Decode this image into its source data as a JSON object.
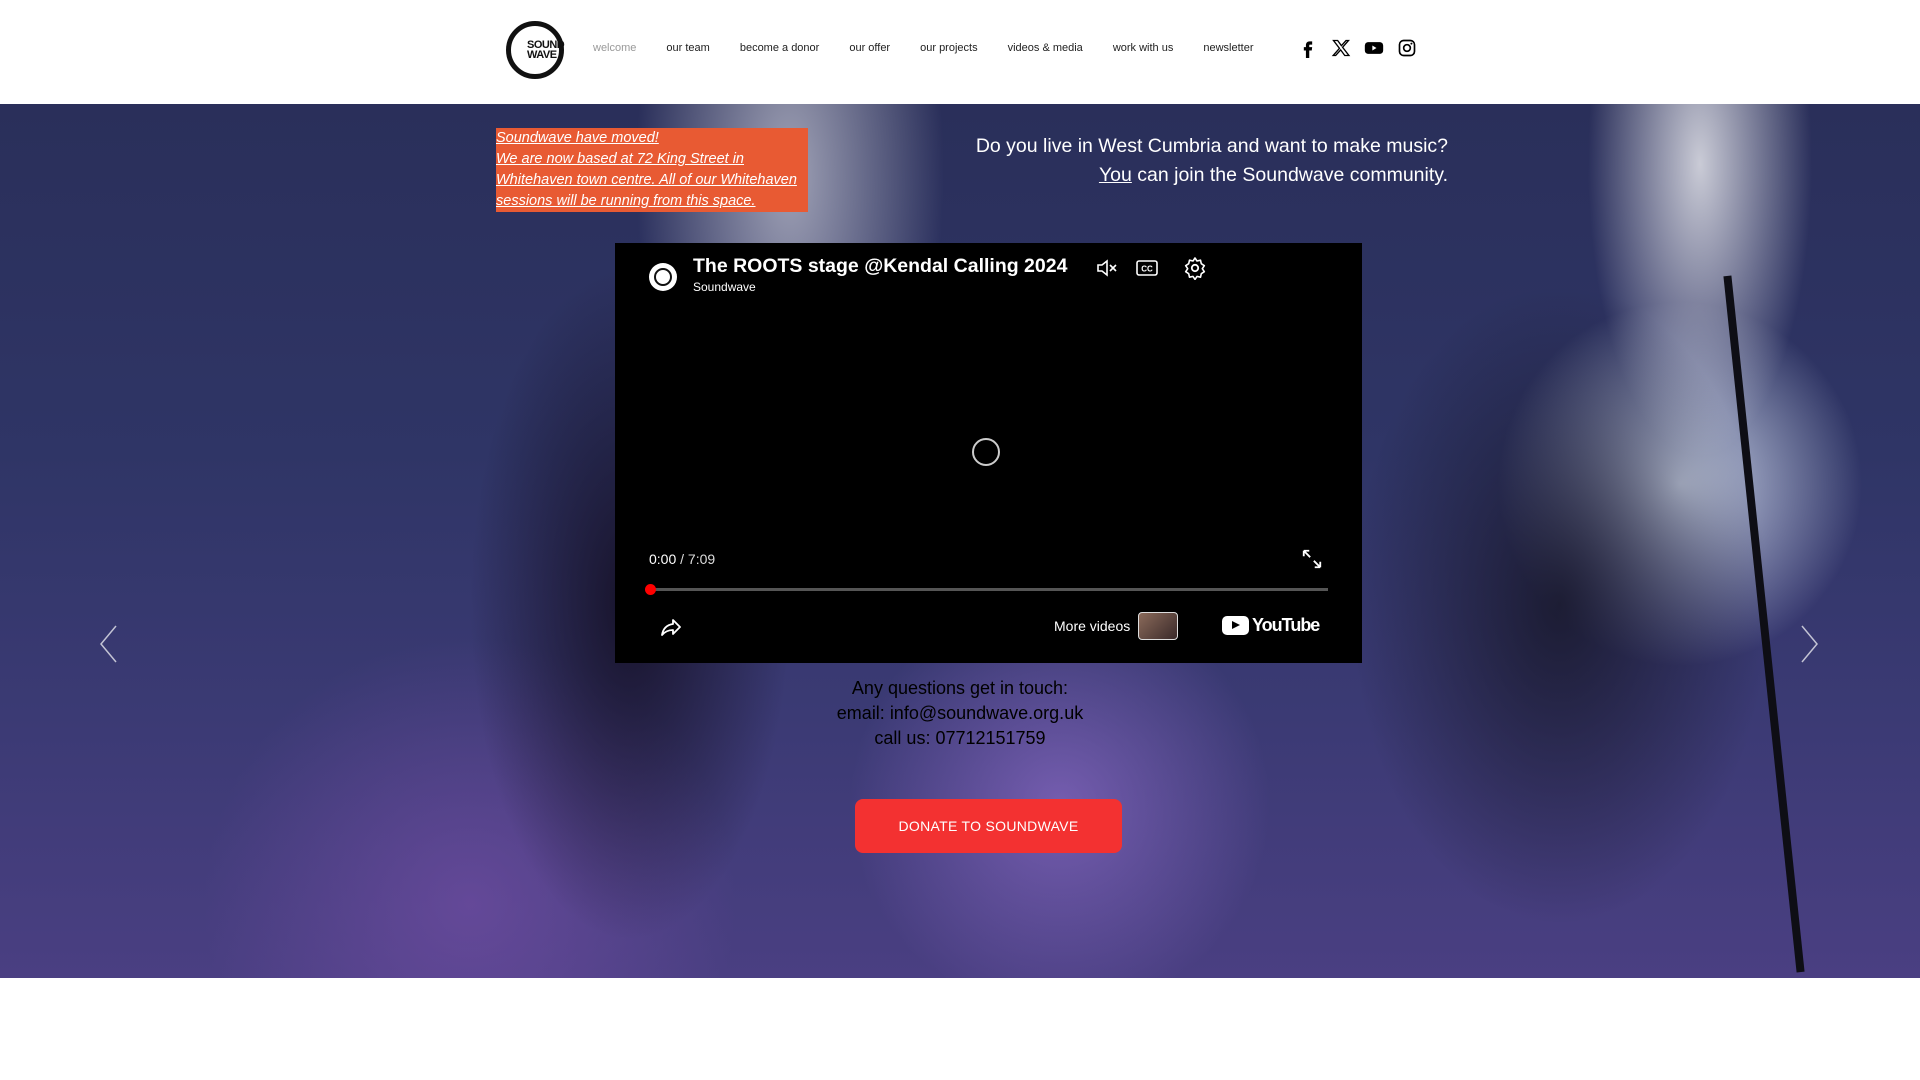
{
  "header": {
    "logo_text_1": "SOUND",
    "logo_text_2": "WAVE",
    "nav": [
      {
        "label": "welcome",
        "active": true
      },
      {
        "label": "our team"
      },
      {
        "label": "become a donor"
      },
      {
        "label": "our offer"
      },
      {
        "label": "our projects"
      },
      {
        "label": "videos & media"
      },
      {
        "label": "work with us"
      },
      {
        "label": "newsletter"
      }
    ],
    "social_icons": [
      "facebook-icon",
      "x-icon",
      "youtube-icon",
      "instagram-icon"
    ]
  },
  "hero": {
    "notice_lines": [
      "Soundwave have moved!",
      "We are now based at 72 King Street in",
      "Whitehaven town centre. All of our Whitehaven",
      "sessions will be running from this space."
    ],
    "cta_line1": "Do you live in West Cumbria and want to make music?",
    "cta_line2_you": "You",
    "cta_line2_rest": " can join the Soundwave community.",
    "accent_color": "#e85a33"
  },
  "video": {
    "title": "The ROOTS stage @Kendal Calling 2024",
    "channel": "Soundwave",
    "time_current": "0:00",
    "time_total": " / 7:09",
    "progress_fraction": 0.0,
    "more_videos": "More videos",
    "youtube_word": "YouTube"
  },
  "contact": {
    "line1": "Any questions get in touch:",
    "line2": "email: info@soundwave.org.uk",
    "line3": "call us: 07712151759"
  },
  "donate": {
    "label": "DONATE TO SOUNDWAVE",
    "color": "#f33131"
  }
}
